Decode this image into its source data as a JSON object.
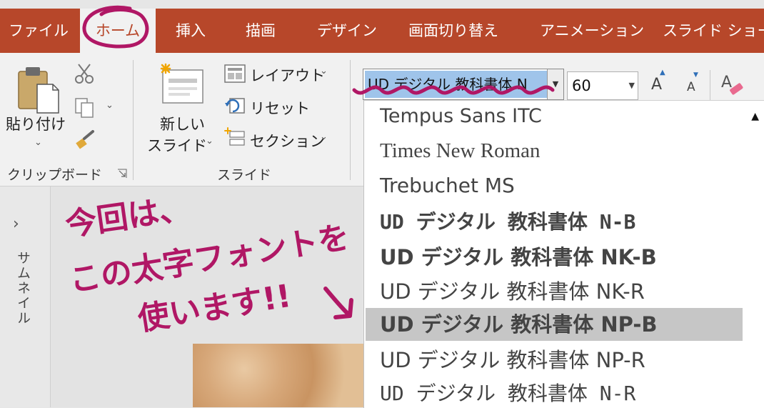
{
  "tabs": [
    "ファイル",
    "ホーム",
    "挿入",
    "描画",
    "デザイン",
    "画面切り替え",
    "アニメーション",
    "スライド ショー"
  ],
  "active_tab": "ホーム",
  "clipboard": {
    "paste_label": "貼り付け",
    "group_label": "クリップボード",
    "cut_icon": "scissors-icon",
    "copy_icon": "copy-icon",
    "format_painter_icon": "brush-icon",
    "launcher_icon": "dialog-launcher-icon"
  },
  "slides": {
    "new_slide_line1": "新しい",
    "new_slide_line2": "スライド",
    "layout_label": "レイアウト",
    "reset_label": "リセット",
    "section_label": "セクション",
    "group_label": "スライド"
  },
  "font": {
    "current_font": "UD デジタル 教科書体 N",
    "current_size": "60",
    "grow_label": "A",
    "shrink_label": "A",
    "clear_format_icon": "eraser-icon"
  },
  "font_list": [
    "Tempus Sans ITC",
    "Times New Roman",
    "Trebuchet MS",
    "UD デジタル 教科書体 N-B",
    "UD デジタル 教科書体 NK-B",
    "UD デジタル 教科書体 NK-R",
    "UD デジタル 教科書体 NP-B",
    "UD デジタル 教科書体 NP-R",
    "UD デジタル 教科書体 N-R"
  ],
  "highlighted_font": "UD デジタル 教科書体 NP-B",
  "thumbnail_pane_label": "サムネイル",
  "handwritten_note": "今回は、この太字フォントを使います!!",
  "colors": {
    "ribbon_red": "#b7472a",
    "annotation": "#b01765",
    "selection_blue": "#9fc4ea",
    "highlight_gray": "#c6c6c6"
  }
}
